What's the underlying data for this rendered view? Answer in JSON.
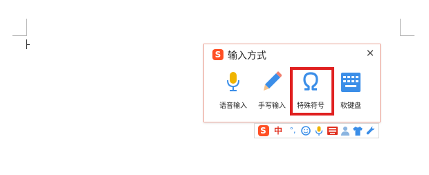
{
  "panel": {
    "title": "输入方式",
    "close_glyph": "✕",
    "options": [
      {
        "label": "语音输入",
        "icon": "microphone-icon"
      },
      {
        "label": "手写输入",
        "icon": "pen-icon"
      },
      {
        "label": "特殊符号",
        "icon": "omega-icon"
      },
      {
        "label": "软键盘",
        "icon": "keyboard-icon"
      }
    ],
    "highlighted_option": "特殊符号"
  },
  "status_bar": {
    "logo": "S",
    "lang": "中",
    "punct": "°,",
    "items": [
      "smiley-icon",
      "microphone-icon",
      "keyboard-icon",
      "user-icon",
      "tshirt-icon",
      "wrench-icon"
    ]
  },
  "colors": {
    "brand": "#ff4f24",
    "highlight_border": "#e02020",
    "accent_blue": "#3b8ee8",
    "mic_yellow": "#f0b400"
  }
}
